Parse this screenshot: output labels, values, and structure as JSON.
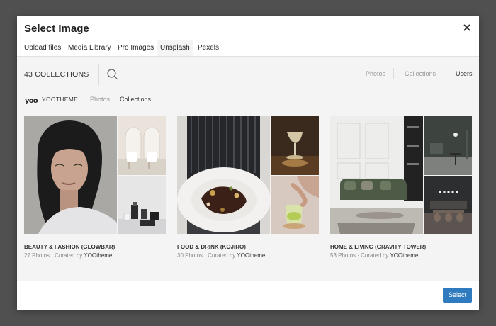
{
  "modal": {
    "title": "Select Image"
  },
  "tabs": [
    {
      "label": "Upload files"
    },
    {
      "label": "Media Library"
    },
    {
      "label": "Pro Images"
    },
    {
      "label": "Unsplash",
      "active": true
    },
    {
      "label": "Pexels"
    }
  ],
  "topbar": {
    "collections_count": "43 COLLECTIONS",
    "search_icon": "search-icon",
    "filters": [
      {
        "label": "Photos"
      },
      {
        "label": "Collections"
      },
      {
        "label": "Users",
        "active": true
      }
    ]
  },
  "user": {
    "logo_text": "yoo",
    "name": "YOOTHEME",
    "links": [
      {
        "label": "Photos"
      },
      {
        "label": "Collections",
        "active": true
      }
    ]
  },
  "collections": [
    {
      "title": "BEAUTY & FASHION (GLOWBAR)",
      "photos": "27 Photos",
      "curated_prefix": " · Curated by ",
      "curator": "YOOtheme"
    },
    {
      "title": "FOOD & DRINK (KOJIRO)",
      "photos": "30 Photos",
      "curated_prefix": " · Curated by ",
      "curator": "YOOtheme"
    },
    {
      "title": "HOME & LIVING (GRAVITY TOWER)",
      "photos": "53 Photos",
      "curated_prefix": " · Curated by ",
      "curator": "YOOtheme"
    }
  ],
  "footer": {
    "select_label": "Select"
  },
  "colors": {
    "overlay": "#505050",
    "accent": "#2f7bbf",
    "content_bg": "#f4f4f4"
  }
}
